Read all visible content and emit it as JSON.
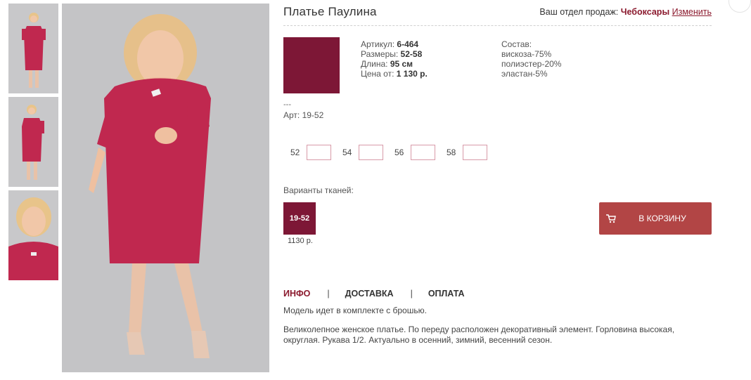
{
  "product": {
    "title": "Платье Паулина",
    "swatch_color": "#7d1736",
    "article_label": "Артикул: ",
    "article": "6-464",
    "sizes_label": "Размеры: ",
    "sizes_range": "52-58",
    "length_label": "Длина: ",
    "length": "95 см",
    "price_label": "Цена от: ",
    "price": "1 130 р.",
    "composition": {
      "label": "Состав:",
      "items": [
        "вискоза-75%",
        "полиэстер-20%",
        "эластан-5%"
      ]
    },
    "art_dash": "---",
    "art_code": "Арт: 19-52"
  },
  "header": {
    "dept_label": "Ваш отдел продаж: ",
    "city": "Чебоксары",
    "change_link": "Изменить"
  },
  "sizes": [
    {
      "label": "52",
      "qty": ""
    },
    {
      "label": "54",
      "qty": ""
    },
    {
      "label": "56",
      "qty": ""
    },
    {
      "label": "58",
      "qty": ""
    }
  ],
  "variants": {
    "label": "Варианты тканей:",
    "items": [
      {
        "code": "19-52",
        "price": "1130 р.",
        "color": "#7d1736"
      }
    ]
  },
  "cart": {
    "label": "В КОРЗИНУ",
    "color": "#b24545",
    "icon": "cart-icon"
  },
  "tabs": {
    "items": [
      "ИНФО",
      "ДОСТАВКА",
      "ОПЛАТА"
    ],
    "separator": "|",
    "active": "ИНФО"
  },
  "description": {
    "line1": "Модель идет в комплекте с брошью.",
    "line2": "Великолепное женское платье. По переду расположен декоративный элемент. Горловина высокая, округлая. Рукава 1/2. Актуально в осенний, зимний, весенний сезон."
  },
  "colors": {
    "accent": "#8b1a2e",
    "dress": "#c0284f",
    "swatch": "#7d1736"
  }
}
